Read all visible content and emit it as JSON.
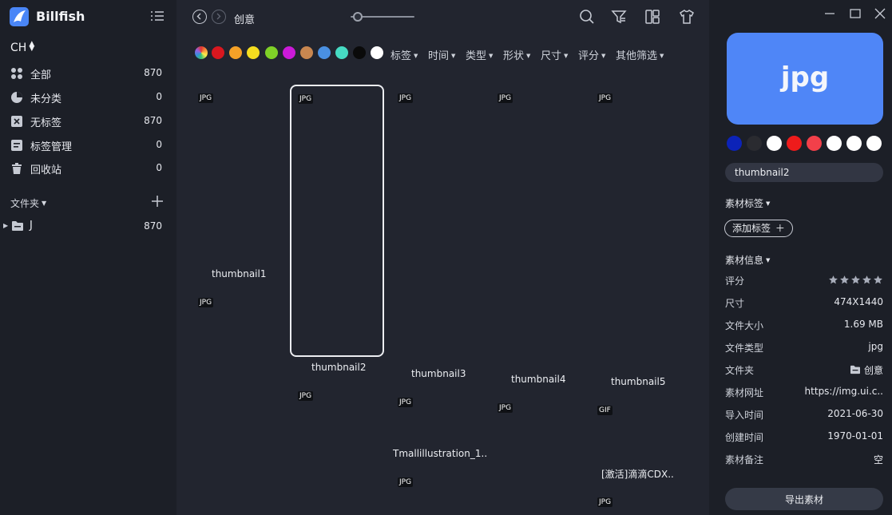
{
  "app": {
    "title": "Billfish",
    "library": "CH"
  },
  "sidebar": {
    "nav": [
      {
        "label": "全部",
        "count": "870",
        "icon": "all-icon"
      },
      {
        "label": "未分类",
        "count": "0",
        "icon": "pie-icon"
      },
      {
        "label": "无标签",
        "count": "870",
        "icon": "untagged-icon"
      },
      {
        "label": "标签管理",
        "count": "0",
        "icon": "tag-manage-icon"
      },
      {
        "label": "回收站",
        "count": "0",
        "icon": "trash-icon"
      }
    ],
    "folders_title": "文件夹",
    "folders": [
      {
        "label": "J",
        "count": "870"
      }
    ]
  },
  "toolbar": {
    "breadcrumb": "创意",
    "zoom_level": 0.05,
    "colors": [
      "#d9171f",
      "#f5a127",
      "#f5dd1f",
      "#7fd127",
      "#cb1ad8",
      "#c98750",
      "#4a90e2",
      "#46dbc3",
      "#0a0a0a",
      "#ffffff"
    ],
    "filters": [
      "标签",
      "时间",
      "类型",
      "形状",
      "尺寸",
      "评分",
      "其他筛选"
    ]
  },
  "grid": {
    "cards": [
      {
        "name": "thumbnail1",
        "type": "JPG",
        "selected": false
      },
      {
        "name": "thumbnail2",
        "type": "JPG",
        "selected": true
      },
      {
        "name": "thumbnail3",
        "type": "JPG",
        "selected": false
      },
      {
        "name": "thumbnail4",
        "type": "JPG",
        "selected": false
      },
      {
        "name": "thumbnail5",
        "type": "JPG",
        "selected": false
      },
      {
        "name": "",
        "type": "JPG",
        "selected": false
      },
      {
        "name": "",
        "type": "JPG",
        "selected": false
      },
      {
        "name": "Tmallillustration_1..",
        "type": "JPG",
        "selected": false
      },
      {
        "name": "",
        "type": "JPG",
        "selected": false
      },
      {
        "name": "[激活]滴滴CDX..",
        "type": "GIF",
        "selected": false
      },
      {
        "name": "",
        "type": "JPG",
        "selected": false
      },
      {
        "name": "",
        "type": "JPG",
        "selected": false
      }
    ]
  },
  "panel": {
    "preview_text": "jpg",
    "palette": [
      "#0c23b8",
      "#2a2b30",
      "#ffffff",
      "#ee1b1b",
      "#f2404a",
      "#ffffff",
      "#ffffff",
      "#ffffff"
    ],
    "file_name": "thumbnail2",
    "tags_title": "素材标签",
    "add_tag": "添加标签",
    "info_title": "素材信息",
    "rating": 0,
    "info": [
      {
        "key": "评分",
        "value": ""
      },
      {
        "key": "尺寸",
        "value": "474X1440"
      },
      {
        "key": "文件大小",
        "value": "1.69 MB"
      },
      {
        "key": "文件类型",
        "value": "jpg"
      },
      {
        "key": "文件夹",
        "value": "创意"
      },
      {
        "key": "素材网址",
        "value": "https://img.ui.c.."
      },
      {
        "key": "导入时间",
        "value": "2021-06-30"
      },
      {
        "key": "创建时间",
        "value": "1970-01-01"
      },
      {
        "key": "素材备注",
        "value": "空"
      }
    ],
    "export_label": "导出素材"
  }
}
